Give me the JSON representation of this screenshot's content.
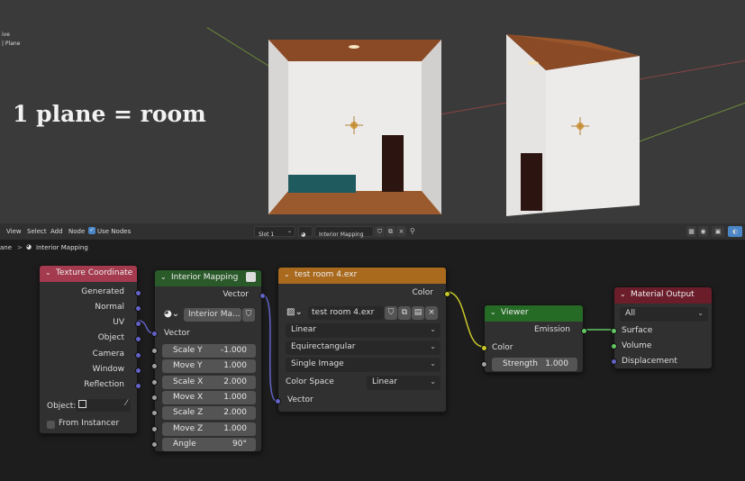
{
  "viewport": {
    "info_line1": "ive",
    "info_line2": "| Plane",
    "overlay_title": "1 plane = room"
  },
  "header": {
    "menu": [
      "View",
      "Select",
      "Add",
      "Node"
    ],
    "use_nodes_label": "Use Nodes",
    "use_nodes_checked": true,
    "slot": "Slot 1",
    "material_name": "Interior Mapping"
  },
  "breadcrumb": {
    "object": "ane",
    "separator": ">",
    "material": "Interior Mapping"
  },
  "nodes": {
    "texture_coordinate": {
      "title": "Texture Coordinate",
      "outputs": [
        "Generated",
        "Normal",
        "UV",
        "Object",
        "Camera",
        "Window",
        "Reflection"
      ],
      "object_label": "Object:",
      "from_instancer": "From Instancer"
    },
    "interior_mapping": {
      "title": "Interior Mapping",
      "output": "Vector",
      "group_name": "Interior Ma...",
      "input": "Vector",
      "fields": [
        {
          "label": "Scale Y",
          "value": "-1.000"
        },
        {
          "label": "Move Y",
          "value": "1.000"
        },
        {
          "label": "Scale X",
          "value": "2.000"
        },
        {
          "label": "Move X",
          "value": "1.000"
        },
        {
          "label": "Scale Z",
          "value": "2.000"
        },
        {
          "label": "Move Z",
          "value": "1.000"
        },
        {
          "label": "Angle",
          "value": "90°"
        }
      ]
    },
    "image_texture": {
      "title": "test room 4.exr",
      "output": "Color",
      "image_name": "test room 4.exr",
      "interpolation": "Linear",
      "projection": "Equirectangular",
      "source": "Single Image",
      "color_space_label": "Color Space",
      "color_space": "Linear",
      "input": "Vector"
    },
    "viewer": {
      "title": "Viewer",
      "output": "Emission",
      "input": "Color",
      "strength_label": "Strength",
      "strength_value": "1.000"
    },
    "material_output": {
      "title": "Material Output",
      "target": "All",
      "inputs": [
        "Surface",
        "Volume",
        "Displacement"
      ]
    }
  },
  "colors": {
    "input_header": "#a43a4e",
    "converter_header": "#2a5a2a",
    "texture_header": "#aa6a1e",
    "viewer_header": "#256a25",
    "output_header": "#6b1d2a",
    "link_vector": "#6363c7",
    "link_color": "#c7c729",
    "link_shader": "#63c763"
  }
}
